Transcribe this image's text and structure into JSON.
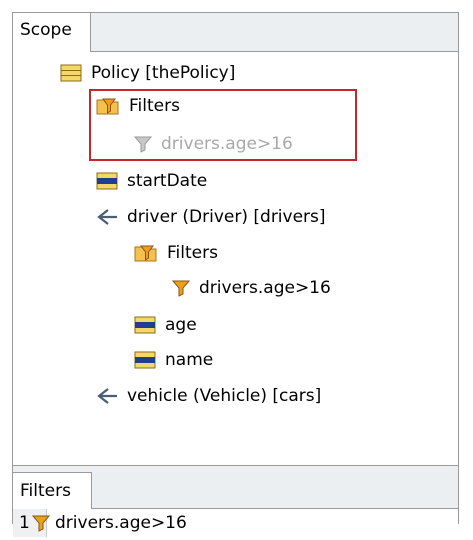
{
  "scope_tab": {
    "label": "Scope"
  },
  "tree": {
    "policy": "Policy [thePolicy]",
    "filters_top": "Filters",
    "filter_top_expr": "drivers.age>16",
    "start_date": "startDate",
    "driver": "driver (Driver) [drivers]",
    "driver_filters": "Filters",
    "driver_filter_expr": "drivers.age>16",
    "age": "age",
    "name": "name",
    "vehicle": "vehicle (Vehicle) [cars]"
  },
  "filters_tab": {
    "label": "Filters"
  },
  "filters_table": {
    "rows": [
      {
        "index": "1",
        "expression": "drivers.age>16"
      }
    ]
  },
  "colors": {
    "highlight": "#c0282d",
    "field_icon": "#1f3f8a",
    "funnel": "#e8a317"
  }
}
